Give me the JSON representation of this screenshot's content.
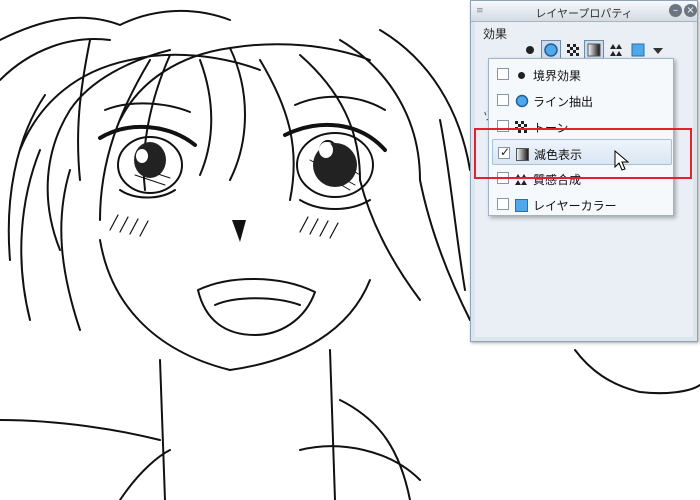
{
  "panel": {
    "title": "レイヤープロパティ",
    "grip_icon": "≡",
    "minimize_label": "–",
    "close_label": "×",
    "section_label": "効果",
    "side_label": "ツ"
  },
  "toolbar": {
    "icons": [
      "border-effect-icon",
      "line-extraction-icon",
      "tone-icon",
      "color-reduction-icon",
      "texture-icon",
      "layer-color-icon",
      "dropdown-arrow-icon"
    ]
  },
  "menu": {
    "items": [
      {
        "label": "境界効果",
        "checked": false,
        "icon": "border-effect-icon"
      },
      {
        "label": "ライン抽出",
        "checked": false,
        "icon": "line-extraction-icon"
      },
      {
        "label": "トーン",
        "checked": false,
        "icon": "tone-icon"
      },
      {
        "label": "減色表示",
        "checked": true,
        "icon": "color-reduction-icon"
      },
      {
        "label": "質感合成",
        "checked": false,
        "icon": "texture-icon"
      },
      {
        "label": "レイヤーカラー",
        "checked": false,
        "icon": "layer-color-icon"
      }
    ],
    "check_mark": "✓"
  },
  "colors": {
    "highlight_box": "#e3202f",
    "layer_color_blue": "#4ea8ea",
    "panel_bg": "#dde6ef"
  }
}
